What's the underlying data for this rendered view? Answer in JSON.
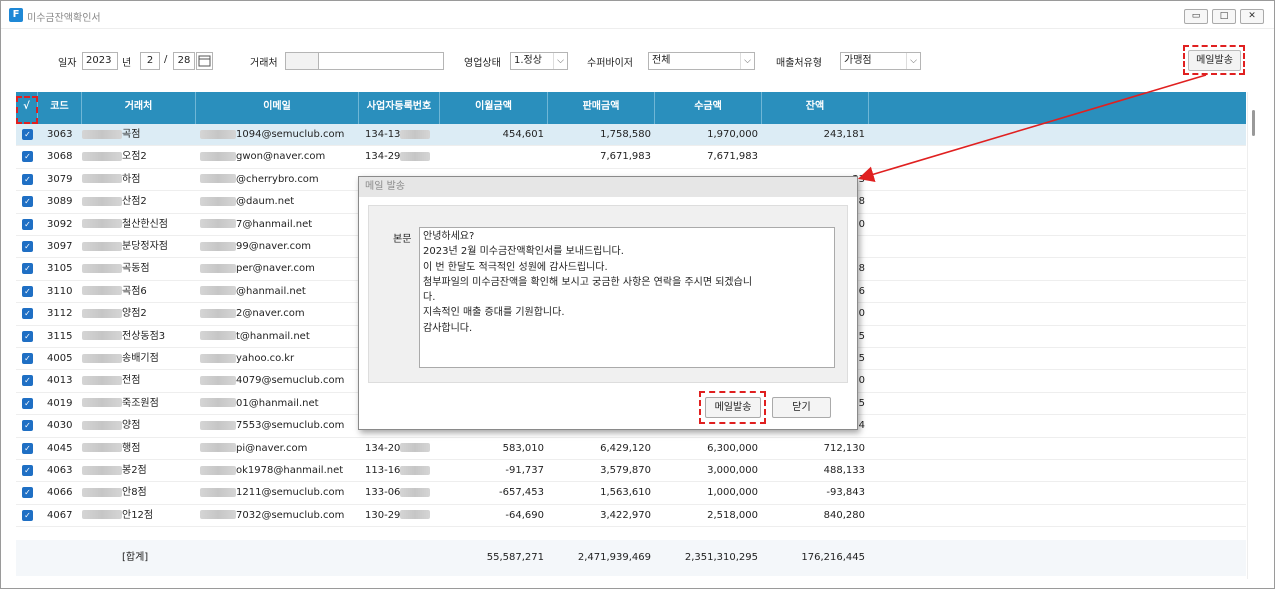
{
  "window": {
    "title": "미수금잔액확인서",
    "app_icon": "F",
    "minimize": "▭",
    "maximize": "□",
    "close": "✕"
  },
  "filters": {
    "date_label": "일자",
    "year": "2023",
    "year_suffix": "년",
    "month": "2",
    "slash": "/",
    "day": "28",
    "customer_label": "거래처",
    "status_label": "영업상태",
    "status_value": "1.정상",
    "supervisor_label": "수퍼바이저",
    "supervisor_value": "전체",
    "sales_type_label": "매출처유형",
    "sales_type_value": "가맹점",
    "send_mail": "메일발송"
  },
  "grid": {
    "headers": {
      "check": "√",
      "code": "코드",
      "customer": "거래처",
      "email": "이메일",
      "bizno": "사업자등록번호",
      "carry": "이월금액",
      "sales": "판매금액",
      "received": "수금액",
      "balance": "잔액"
    },
    "rows": [
      {
        "code": "3063",
        "name": "곡점",
        "email": "1094@semuclub.com",
        "bizno": "134-13",
        "carry": "454,601",
        "sales": "1,758,580",
        "received": "1,970,000",
        "balance": "243,181"
      },
      {
        "code": "3068",
        "name": "오점2",
        "email": "gwon@naver.com",
        "bizno": "134-29",
        "carry": "",
        "sales": "7,671,983",
        "received": "7,671,983",
        "balance": ""
      },
      {
        "code": "3079",
        "name": "하점",
        "email": "@cherrybro.com",
        "bizno": "",
        "carry": "",
        "sales": "",
        "received": "",
        "balance": "33"
      },
      {
        "code": "3089",
        "name": "산점2",
        "email": "@daum.net",
        "bizno": "",
        "carry": "",
        "sales": "",
        "received": "",
        "balance": "38"
      },
      {
        "code": "3092",
        "name": "철산한신점",
        "email": "7@hanmail.net",
        "bizno": "",
        "carry": "",
        "sales": "",
        "received": "",
        "balance": "50"
      },
      {
        "code": "3097",
        "name": "분당정자점",
        "email": "99@naver.com",
        "bizno": "",
        "carry": "",
        "sales": "",
        "received": "",
        "balance": ""
      },
      {
        "code": "3105",
        "name": "곡동점",
        "email": "per@naver.com",
        "bizno": "",
        "carry": "",
        "sales": "",
        "received": "",
        "balance": "18"
      },
      {
        "code": "3110",
        "name": "곡점6",
        "email": "@hanmail.net",
        "bizno": "",
        "carry": "",
        "sales": "",
        "received": "",
        "balance": "56"
      },
      {
        "code": "3112",
        "name": "양점2",
        "email": "2@naver.com",
        "bizno": "",
        "carry": "",
        "sales": "",
        "received": "",
        "balance": "30"
      },
      {
        "code": "3115",
        "name": "전상동점3",
        "email": "t@hanmail.net",
        "bizno": "",
        "carry": "",
        "sales": "",
        "received": "",
        "balance": "95"
      },
      {
        "code": "4005",
        "name": "송배기점",
        "email": "yahoo.co.kr",
        "bizno": "",
        "carry": "",
        "sales": "",
        "received": "",
        "balance": "25"
      },
      {
        "code": "4013",
        "name": "전점",
        "email": "4079@semuclub.com",
        "bizno": "",
        "carry": "",
        "sales": "",
        "received": "",
        "balance": "70"
      },
      {
        "code": "4019",
        "name": "죽조원점",
        "email": "01@hanmail.net",
        "bizno": "",
        "carry": "",
        "sales": "",
        "received": "",
        "balance": "45"
      },
      {
        "code": "4030",
        "name": "양점",
        "email": "7553@semuclub.com",
        "bizno": "",
        "carry": "",
        "sales": "",
        "received": "",
        "balance": "24"
      },
      {
        "code": "4045",
        "name": "행점",
        "email": "pi@naver.com",
        "bizno": "134-20",
        "carry": "583,010",
        "sales": "6,429,120",
        "received": "6,300,000",
        "balance": "712,130"
      },
      {
        "code": "4063",
        "name": "봉2점",
        "email": "ok1978@hanmail.net",
        "bizno": "113-16",
        "carry": "-91,737",
        "sales": "3,579,870",
        "received": "3,000,000",
        "balance": "488,133"
      },
      {
        "code": "4066",
        "name": "안8점",
        "email": "1211@semuclub.com",
        "bizno": "133-06",
        "carry": "-657,453",
        "sales": "1,563,610",
        "received": "1,000,000",
        "balance": "-93,843"
      },
      {
        "code": "4067",
        "name": "안12점",
        "email": "7032@semuclub.com",
        "bizno": "130-29",
        "carry": "-64,690",
        "sales": "3,422,970",
        "received": "2,518,000",
        "balance": "840,280"
      }
    ],
    "footer": {
      "label": "[합계]",
      "carry": "55,587,271",
      "sales": "2,471,939,469",
      "received": "2,351,310,295",
      "balance": "176,216,445"
    }
  },
  "dialog": {
    "title": "메일 발송",
    "body_label": "본문",
    "body": "안녕하세요?\n2023년 2월 미수금잔액확인서를 보내드립니다.\n이 번 한달도 적극적인 성원에 감사드립니다.\n첨부파일의 미수금잔액을 확인해 보시고 궁금한 사항은 연락을 주시면 되겠습니\n다.\n지속적인 매출 증대를 기원합니다.\n감사합니다.",
    "send_button": "메일발송",
    "close_button": "닫기"
  },
  "colors": {
    "header_bg": "#2a8fbd",
    "selected_row": "#dcecf5",
    "annotation": "#e02020"
  }
}
